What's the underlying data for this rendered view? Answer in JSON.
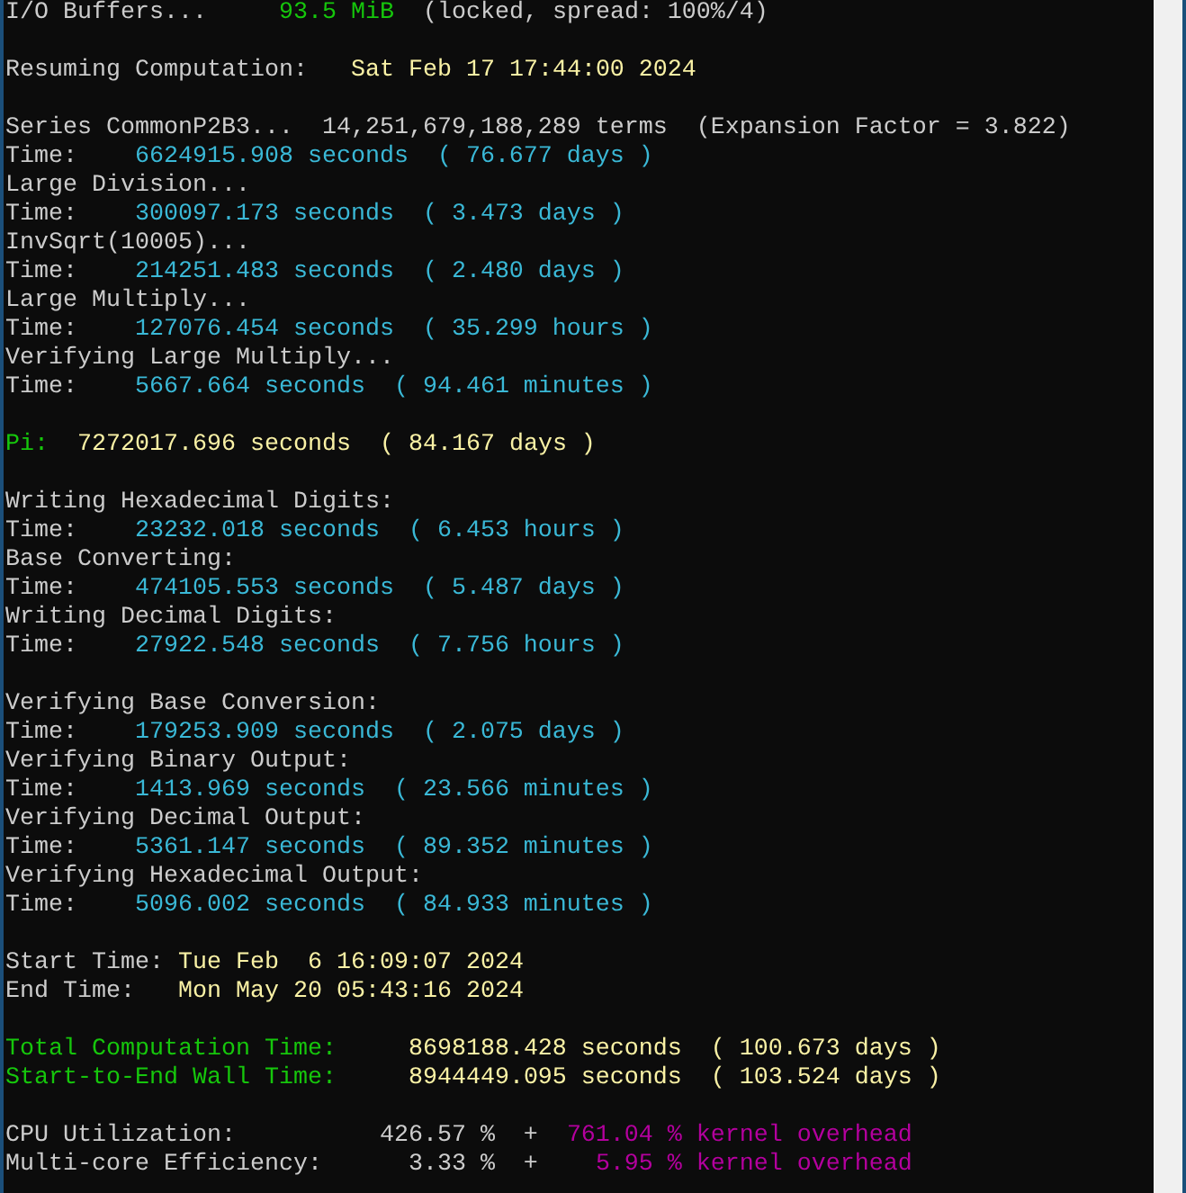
{
  "terminal": {
    "lines": [
      {
        "kind": "text",
        "segments": [
          {
            "text": "I/O Buffers...     ",
            "color": "#cccccc"
          },
          {
            "text": "93.5 MiB",
            "color": "#16c60c"
          },
          {
            "text": "  (locked, spread: 100%/4)",
            "color": "#cccccc"
          }
        ]
      },
      {
        "kind": "blank"
      },
      {
        "kind": "text",
        "segments": [
          {
            "text": "Resuming Computation:   ",
            "color": "#cccccc"
          },
          {
            "text": "Sat Feb 17 17:44:00 2024",
            "color": "#f9f1a5"
          }
        ]
      },
      {
        "kind": "blank"
      },
      {
        "kind": "text",
        "segments": [
          {
            "text": "Series CommonP2B3...  14,251,679,188,289 terms  (Expansion Factor = 3.822)",
            "color": "#cccccc"
          }
        ]
      },
      {
        "kind": "text",
        "segments": [
          {
            "text": "Time:    ",
            "color": "#cccccc"
          },
          {
            "text": "6624915.908 seconds  ( 76.677 days )",
            "color": "#3ab8d6"
          }
        ]
      },
      {
        "kind": "text",
        "segments": [
          {
            "text": "Large Division...",
            "color": "#cccccc"
          }
        ]
      },
      {
        "kind": "text",
        "segments": [
          {
            "text": "Time:    ",
            "color": "#cccccc"
          },
          {
            "text": "300097.173 seconds  ( 3.473 days )",
            "color": "#3ab8d6"
          }
        ]
      },
      {
        "kind": "text",
        "segments": [
          {
            "text": "InvSqrt(10005)...",
            "color": "#cccccc"
          }
        ]
      },
      {
        "kind": "text",
        "segments": [
          {
            "text": "Time:    ",
            "color": "#cccccc"
          },
          {
            "text": "214251.483 seconds  ( 2.480 days )",
            "color": "#3ab8d6"
          }
        ]
      },
      {
        "kind": "text",
        "segments": [
          {
            "text": "Large Multiply...",
            "color": "#cccccc"
          }
        ]
      },
      {
        "kind": "text",
        "segments": [
          {
            "text": "Time:    ",
            "color": "#cccccc"
          },
          {
            "text": "127076.454 seconds  ( 35.299 hours )",
            "color": "#3ab8d6"
          }
        ]
      },
      {
        "kind": "text",
        "segments": [
          {
            "text": "Verifying Large Multiply...",
            "color": "#cccccc"
          }
        ]
      },
      {
        "kind": "text",
        "segments": [
          {
            "text": "Time:    ",
            "color": "#cccccc"
          },
          {
            "text": "5667.664 seconds  ( 94.461 minutes )",
            "color": "#3ab8d6"
          }
        ]
      },
      {
        "kind": "blank"
      },
      {
        "kind": "text",
        "segments": [
          {
            "text": "Pi:  ",
            "color": "#16c60c"
          },
          {
            "text": "7272017.696 seconds  ( 84.167 days )",
            "color": "#f9f1a5"
          }
        ]
      },
      {
        "kind": "blank"
      },
      {
        "kind": "text",
        "segments": [
          {
            "text": "Writing Hexadecimal Digits:",
            "color": "#cccccc"
          }
        ]
      },
      {
        "kind": "text",
        "segments": [
          {
            "text": "Time:    ",
            "color": "#cccccc"
          },
          {
            "text": "23232.018 seconds  ( 6.453 hours )",
            "color": "#3ab8d6"
          }
        ]
      },
      {
        "kind": "text",
        "segments": [
          {
            "text": "Base Converting:",
            "color": "#cccccc"
          }
        ]
      },
      {
        "kind": "text",
        "segments": [
          {
            "text": "Time:    ",
            "color": "#cccccc"
          },
          {
            "text": "474105.553 seconds  ( 5.487 days )",
            "color": "#3ab8d6"
          }
        ]
      },
      {
        "kind": "text",
        "segments": [
          {
            "text": "Writing Decimal Digits:",
            "color": "#cccccc"
          }
        ]
      },
      {
        "kind": "text",
        "segments": [
          {
            "text": "Time:    ",
            "color": "#cccccc"
          },
          {
            "text": "27922.548 seconds  ( 7.756 hours )",
            "color": "#3ab8d6"
          }
        ]
      },
      {
        "kind": "blank"
      },
      {
        "kind": "text",
        "segments": [
          {
            "text": "Verifying Base Conversion:",
            "color": "#cccccc"
          }
        ]
      },
      {
        "kind": "text",
        "segments": [
          {
            "text": "Time:    ",
            "color": "#cccccc"
          },
          {
            "text": "179253.909 seconds  ( 2.075 days )",
            "color": "#3ab8d6"
          }
        ]
      },
      {
        "kind": "text",
        "segments": [
          {
            "text": "Verifying Binary Output:",
            "color": "#cccccc"
          }
        ]
      },
      {
        "kind": "text",
        "segments": [
          {
            "text": "Time:    ",
            "color": "#cccccc"
          },
          {
            "text": "1413.969 seconds  ( 23.566 minutes )",
            "color": "#3ab8d6"
          }
        ]
      },
      {
        "kind": "text",
        "segments": [
          {
            "text": "Verifying Decimal Output:",
            "color": "#cccccc"
          }
        ]
      },
      {
        "kind": "text",
        "segments": [
          {
            "text": "Time:    ",
            "color": "#cccccc"
          },
          {
            "text": "5361.147 seconds  ( 89.352 minutes )",
            "color": "#3ab8d6"
          }
        ]
      },
      {
        "kind": "text",
        "segments": [
          {
            "text": "Verifying Hexadecimal Output:",
            "color": "#cccccc"
          }
        ]
      },
      {
        "kind": "text",
        "segments": [
          {
            "text": "Time:    ",
            "color": "#cccccc"
          },
          {
            "text": "5096.002 seconds  ( 84.933 minutes )",
            "color": "#3ab8d6"
          }
        ]
      },
      {
        "kind": "blank"
      },
      {
        "kind": "text",
        "segments": [
          {
            "text": "Start Time: ",
            "color": "#cccccc"
          },
          {
            "text": "Tue Feb  6 16:09:07 2024",
            "color": "#f9f1a5"
          }
        ]
      },
      {
        "kind": "text",
        "segments": [
          {
            "text": "End Time:   ",
            "color": "#cccccc"
          },
          {
            "text": "Mon May 20 05:43:16 2024",
            "color": "#f9f1a5"
          }
        ]
      },
      {
        "kind": "blank"
      },
      {
        "kind": "text",
        "segments": [
          {
            "text": "Total Computation Time:     ",
            "color": "#16c60c"
          },
          {
            "text": "8698188.428 seconds  ( 100.673 days )",
            "color": "#f9f1a5"
          }
        ]
      },
      {
        "kind": "text",
        "segments": [
          {
            "text": "Start-to-End Wall Time:     ",
            "color": "#16c60c"
          },
          {
            "text": "8944449.095 seconds  ( 103.524 days )",
            "color": "#f9f1a5"
          }
        ]
      },
      {
        "kind": "blank"
      },
      {
        "kind": "text",
        "segments": [
          {
            "text": "CPU Utilization:          426.57 %  +  ",
            "color": "#cccccc"
          },
          {
            "text": "761.04 % kernel overhead",
            "color": "#b4009e"
          }
        ]
      },
      {
        "kind": "text",
        "segments": [
          {
            "text": "Multi-core Efficiency:      3.33 %  +    ",
            "color": "#cccccc"
          },
          {
            "text": "5.95 % kernel overhead",
            "color": "#b4009e"
          }
        ]
      }
    ]
  }
}
